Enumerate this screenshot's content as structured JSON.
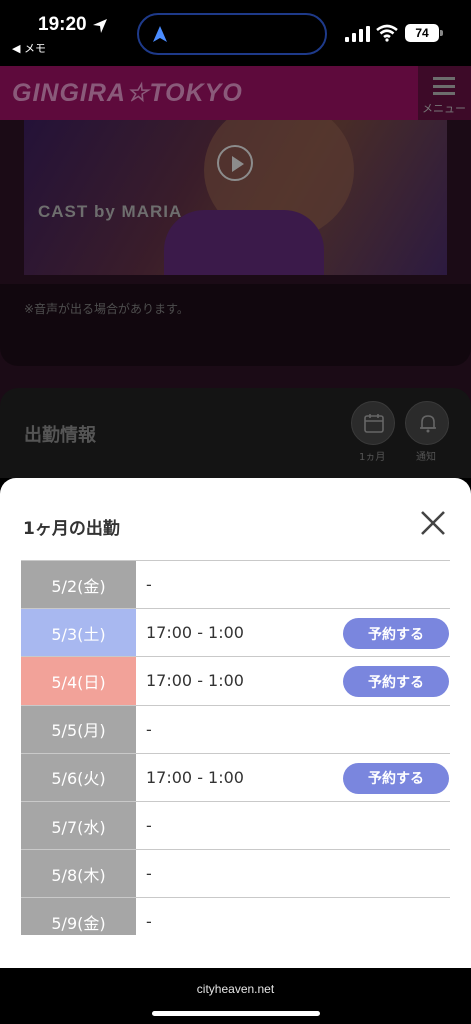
{
  "status_bar": {
    "time": "19:20",
    "back_app": "◀ メモ",
    "battery": "74"
  },
  "site": {
    "logo": "GINGIRA☆TOKYO",
    "menu_label": "メニュー",
    "video_caption": "CAST by MARIA",
    "audio_note": "※音声が出る場合があります。",
    "section_title": "出勤情報",
    "month_button_label": "1ヵ月",
    "notify_button_label": "通知"
  },
  "sheet": {
    "title": "1ヶ月の出勤",
    "reserve_label": "予約する",
    "rows": [
      {
        "date": "5/2(金)",
        "time": "-",
        "day_type": "weekday",
        "reservable": false
      },
      {
        "date": "5/3(土)",
        "time": "17:00 - 1:00",
        "day_type": "saturday",
        "reservable": true
      },
      {
        "date": "5/4(日)",
        "time": "17:00 - 1:00",
        "day_type": "sunday",
        "reservable": true
      },
      {
        "date": "5/5(月)",
        "time": "-",
        "day_type": "weekday",
        "reservable": false
      },
      {
        "date": "5/6(火)",
        "time": "17:00 - 1:00",
        "day_type": "weekday",
        "reservable": true
      },
      {
        "date": "5/7(水)",
        "time": "-",
        "day_type": "weekday",
        "reservable": false
      },
      {
        "date": "5/8(木)",
        "time": "-",
        "day_type": "weekday",
        "reservable": false
      },
      {
        "date": "5/9(金)",
        "time": "-",
        "day_type": "weekday",
        "reservable": false
      }
    ]
  },
  "browser": {
    "url": "cityheaven.net"
  },
  "colors": {
    "reserve_button": "#7a86de",
    "weekday_cell": "#a6a6a6",
    "saturday_cell": "#a8b8f0",
    "sunday_cell": "#f2a299"
  }
}
